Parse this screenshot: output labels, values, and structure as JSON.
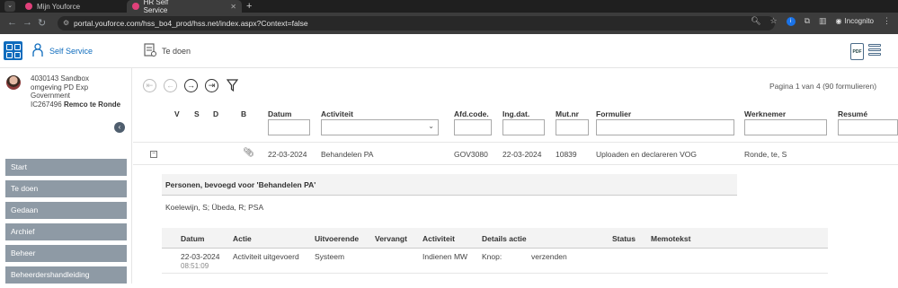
{
  "browser": {
    "tabs": [
      {
        "title": "Mijn Youforce",
        "active": false
      },
      {
        "title": "HR Self Service",
        "active": true
      }
    ],
    "url": "portal.youforce.com/hss_bo4_prod/hss.net/index.aspx?Context=false",
    "incognito_label": "Incognito"
  },
  "app": {
    "self_service_label": "Self Service",
    "todo_label": "Te doen",
    "pdf_label": "PDF"
  },
  "user": {
    "line1": "4030143 Sandbox",
    "line2": "omgeving PD Exp",
    "line3": "Government",
    "id": "IC267496",
    "name": "Remco te Ronde"
  },
  "sidebar": {
    "items": [
      "Start",
      "Te doen",
      "Gedaan",
      "Archief",
      "Beheer",
      "Beheerdershandleiding"
    ]
  },
  "pager": "Pagina 1 van 4 (90 formulieren)",
  "columns": {
    "v": "V",
    "s": "S",
    "d": "D",
    "b": "B",
    "datum": "Datum",
    "activiteit": "Activiteit",
    "afd": "Afd.code.",
    "ingdat": "Ing.dat.",
    "mutnr": "Mut.nr",
    "formulier": "Formulier",
    "werknemer": "Werknemer",
    "resume": "Resumé"
  },
  "row": {
    "datum": "22-03-2024",
    "activiteit": "Behandelen PA",
    "afd": "GOV3080",
    "ingdat": "22-03-2024",
    "mutnr": "10839",
    "formulier": "Uploaden en declareren VOG",
    "werknemer": "Ronde, te, S"
  },
  "detail": {
    "title": "Personen, bevoegd voor 'Behandelen PA'",
    "persons": "Koelewijn, S; Übeda, R; PSA"
  },
  "history": {
    "headers": {
      "datum": "Datum",
      "actie": "Actie",
      "uitvoerende": "Uitvoerende",
      "vervangt": "Vervangt",
      "activiteit": "Activiteit",
      "details": "Details actie",
      "status": "Status",
      "memo": "Memotekst"
    },
    "row": {
      "datum": "22-03-2024",
      "tijd": "08:51:09",
      "actie": "Activiteit uitgevoerd",
      "uitvoerende": "Systeem",
      "activiteit": "Indienen MW",
      "details_key": "Knop:",
      "details_val": "verzenden"
    }
  }
}
